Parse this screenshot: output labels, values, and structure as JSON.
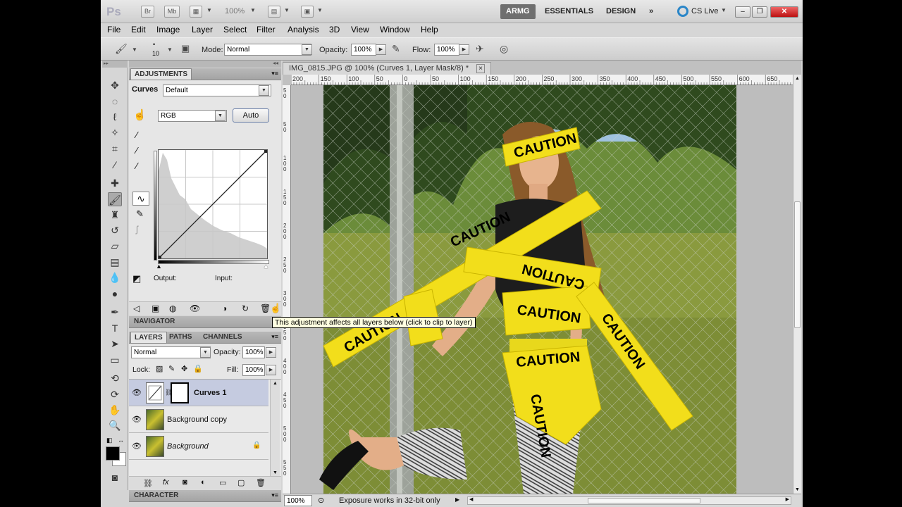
{
  "appbar": {
    "logo": "Ps",
    "btn_br": "Br",
    "btn_mb": "Mb",
    "zoom": "100%",
    "workspaces": [
      "ARMG",
      "ESSENTIALS",
      "DESIGN"
    ],
    "more": "»",
    "cslive": "CS Live"
  },
  "menu": [
    "File",
    "Edit",
    "Image",
    "Layer",
    "Select",
    "Filter",
    "Analysis",
    "3D",
    "View",
    "Window",
    "Help"
  ],
  "options": {
    "brush_size": "10",
    "mode_label": "Mode:",
    "mode_value": "Normal",
    "opacity_label": "Opacity:",
    "opacity_value": "100%",
    "flow_label": "Flow:",
    "flow_value": "100%"
  },
  "adjustments": {
    "tab": "ADJUSTMENTS",
    "preset_label": "Curves",
    "preset_value": "Default",
    "channel": "RGB",
    "auto_button": "Auto",
    "output_label": "Output:",
    "input_label": "Input:"
  },
  "navigator_tab": "NAVIGATOR",
  "tooltip": "This adjustment affects all layers below (click to clip to layer)",
  "layers": {
    "tabs": [
      "LAYERS",
      "PATHS",
      "CHANNELS"
    ],
    "blend": "Normal",
    "opacity_label": "Opacity:",
    "opacity_value": "100%",
    "lock_label": "Lock:",
    "fill_label": "Fill:",
    "fill_value": "100%",
    "items": [
      {
        "name": "Curves 1"
      },
      {
        "name": "Background copy"
      },
      {
        "name": "Background"
      }
    ]
  },
  "character_tab": "CHARACTER",
  "document": {
    "tab_title": "IMG_0815.JPG @ 100% (Curves 1, Layer Mask/8) *",
    "close": "×",
    "ruler_h": [
      "200",
      "150",
      "100",
      "50",
      "0",
      "50",
      "100",
      "150",
      "200",
      "250",
      "300",
      "350",
      "400",
      "450",
      "500",
      "550",
      "600",
      "650"
    ],
    "ruler_v": [
      "5 0",
      "5 0",
      "1 0 0",
      "1 5 0",
      "2 0 0",
      "2 5 0",
      "3 0 0",
      "3 5 0",
      "4 0 0",
      "4 5 0",
      "5 0 0",
      "5 5 0"
    ],
    "zoom_status": "100%",
    "status_text": "Exposure works in 32-bit only",
    "tape_words": [
      "CAUTION",
      "CAUTION",
      "CAUTION",
      "CAUTION",
      "CAUTION",
      "CAUTION",
      "CAUTION",
      "CAUTION"
    ]
  }
}
